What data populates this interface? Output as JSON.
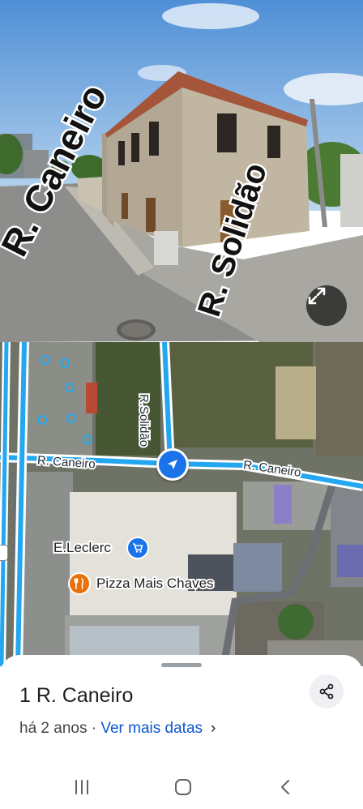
{
  "street_view": {
    "labels": {
      "street_left": "R. Caneiro",
      "street_right": "R. Solidão"
    },
    "expand_icon": "expand-arrows-icon"
  },
  "map": {
    "streets": {
      "caneiro_west": "R. Caneiro",
      "caneiro_east": "R. Caneiro",
      "solidao": "R.Solidão"
    },
    "pois": [
      {
        "name": "E.Leclerc",
        "icon": "shopping-cart-icon",
        "color": "#1a73e8"
      },
      {
        "name": "Pizza Mais Chaves",
        "icon": "fork-knife-icon",
        "color": "#e8710a"
      }
    ],
    "location_icon": "navigation-arrow-icon"
  },
  "sheet": {
    "title": "1 R. Caneiro",
    "meta_prefix": "há 2 anos · ",
    "meta_link": "Ver mais datas",
    "meta_chevron": "›",
    "share_icon": "share-icon"
  },
  "navbar": {
    "recents_icon": "recents-icon",
    "home_icon": "home-icon",
    "back_icon": "back-icon"
  },
  "colors": {
    "accent": "#1a73e8",
    "link": "#0b57d0",
    "road_highlight": "#22a7f0",
    "poi_food": "#e8710a"
  }
}
